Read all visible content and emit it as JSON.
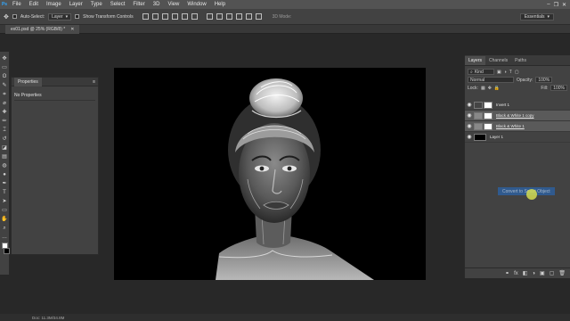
{
  "menu": [
    "File",
    "Edit",
    "Image",
    "Layer",
    "Type",
    "Select",
    "Filter",
    "3D",
    "View",
    "Window",
    "Help"
  ],
  "logo": "Ps",
  "window_controls": [
    "–",
    "❐",
    "✕"
  ],
  "options": {
    "auto_select_label": "Auto-Select:",
    "auto_select_value": "Layer",
    "transform_label": "Show Transform Controls",
    "mode3d_label": "3D Mode:",
    "workspace": "Essentials"
  },
  "document": {
    "tab_title": "ex01.psd @ 25% (RGB/8) *",
    "status": "Doc: 11.3M/34.8M"
  },
  "toolbar": {
    "tools": [
      "move-tool",
      "marquee-tool",
      "lasso-tool",
      "quick-select-tool",
      "crop-tool",
      "eyedropper-tool",
      "healing-tool",
      "brush-tool",
      "stamp-tool",
      "history-brush-tool",
      "eraser-tool",
      "gradient-tool",
      "blur-tool",
      "dodge-tool",
      "pen-tool",
      "type-tool",
      "path-select-tool",
      "shape-tool",
      "hand-tool",
      "zoom-tool",
      "more-tool"
    ],
    "glyphs": [
      "✥",
      "▭",
      "ʘ",
      "✎",
      "⌗",
      "⌀",
      "✚",
      "✏",
      "⌶",
      "↺",
      "◪",
      "▤",
      "◍",
      "●",
      "✒",
      "T",
      "➤",
      "▭",
      "✋",
      "⌕",
      "…"
    ]
  },
  "properties": {
    "title": "Properties",
    "empty": "No Properties"
  },
  "layers_panel": {
    "tabs": [
      "Layers",
      "Channels",
      "Paths"
    ],
    "filter_label": "Kind",
    "blend_mode": "Normal",
    "opacity_label": "Opacity:",
    "opacity_value": "100%",
    "lock_label": "Lock:",
    "fill_label": "Fill:",
    "fill_value": "100%",
    "layers": [
      {
        "name": "Invert 1",
        "thumb": "#ffffff",
        "selected": false
      },
      {
        "name": "Black & White 1 copy",
        "thumb": "#dddddd",
        "selected": true
      },
      {
        "name": "Black & White 1",
        "thumb": "#dddddd",
        "selected": true
      },
      {
        "name": "Layer 1",
        "thumb": "#000000",
        "selected": false
      }
    ],
    "footer_icons": [
      "⚭",
      "fx",
      "◧",
      "◑",
      "▣",
      "▢",
      "🗑"
    ]
  },
  "tooltip": "Convert to Smart Object",
  "colors": {
    "accent": "#2a63a8",
    "panel": "#424242",
    "canvas_bg": "#000000"
  }
}
